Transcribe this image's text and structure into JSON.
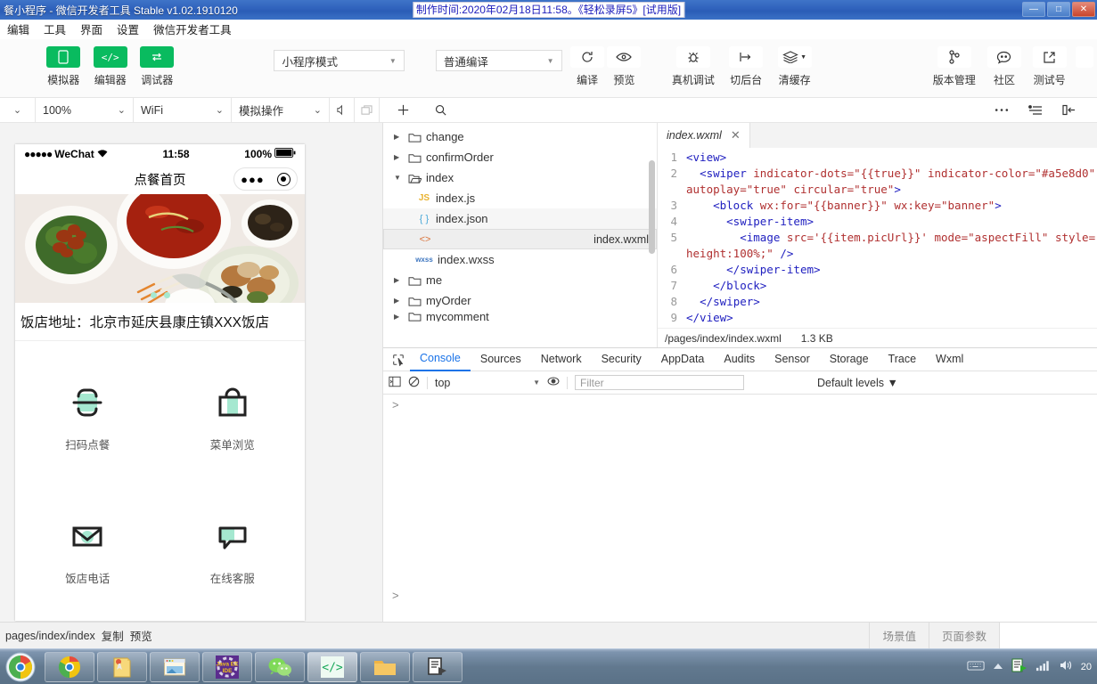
{
  "window": {
    "title": "餐小程序 - 微信开发者工具 Stable v1.02.1910120",
    "recording_overlay": "制作时间:2020年02月18日11:58。《轻松录屏5》[试用版]",
    "minimize": "—",
    "maximize": "□",
    "close": "✕"
  },
  "menubar": [
    "编辑",
    "工具",
    "界面",
    "设置",
    "微信开发者工具"
  ],
  "toolbar": {
    "left_items": [
      {
        "label": "模拟器",
        "icon": "simulator-icon",
        "glyph": "▯"
      },
      {
        "label": "编辑器",
        "icon": "editor-icon",
        "glyph": "‹/›"
      },
      {
        "label": "调试器",
        "icon": "debugger-icon",
        "glyph": "⇄"
      }
    ],
    "mode_select": "小程序模式",
    "compile_select": "普通编译",
    "actions": [
      {
        "label": "编译",
        "icon": "refresh-icon",
        "glyph": "↻"
      },
      {
        "label": "预览",
        "icon": "eye-icon",
        "glyph": "◉"
      },
      {
        "label": "真机调试",
        "icon": "bug-icon",
        "glyph": "※"
      },
      {
        "label": "切后台",
        "icon": "background-icon",
        "glyph": "↦"
      },
      {
        "label": "清缓存",
        "icon": "layers-icon",
        "glyph": "≋"
      }
    ],
    "right_actions": [
      {
        "label": "版本管理",
        "icon": "branch-icon",
        "glyph": "⑂"
      },
      {
        "label": "社区",
        "icon": "chat-icon",
        "glyph": "☺"
      },
      {
        "label": "测试号",
        "icon": "external-link-icon",
        "glyph": "↗"
      }
    ]
  },
  "toolbar2": {
    "device_caret": "⌄",
    "zoom": "100%",
    "network": "WiFi",
    "simulate": "模拟操作",
    "mute_icon": "speaker-icon",
    "window_icon": "window-icon",
    "add_icon": "plus-icon",
    "search_icon": "search-icon",
    "more_icon": "more-icon",
    "outline_icon": "outline-icon",
    "collapse_icon": "collapse-panel-icon"
  },
  "filetree": {
    "items": [
      {
        "label": "change",
        "type": "folder",
        "depth": 0,
        "arrow": "▶",
        "state": "normal"
      },
      {
        "label": "confirmOrder",
        "type": "folder",
        "depth": 0,
        "arrow": "▶",
        "state": "normal"
      },
      {
        "label": "index",
        "type": "folder-open",
        "depth": 0,
        "arrow": "▼",
        "state": "normal"
      },
      {
        "label": "index.js",
        "type": "js",
        "depth": 1,
        "arrow": "",
        "state": "normal"
      },
      {
        "label": "index.json",
        "type": "json",
        "depth": 1,
        "arrow": "",
        "state": "hover"
      },
      {
        "label": "index.wxml",
        "type": "wxml",
        "depth": 1,
        "arrow": "",
        "state": "selected"
      },
      {
        "label": "index.wxss",
        "type": "wxss",
        "depth": 1,
        "arrow": "",
        "state": "normal"
      },
      {
        "label": "me",
        "type": "folder",
        "depth": 0,
        "arrow": "▶",
        "state": "normal"
      },
      {
        "label": "myOrder",
        "type": "folder",
        "depth": 0,
        "arrow": "▶",
        "state": "normal"
      },
      {
        "label": "mycomment",
        "type": "folder",
        "depth": 0,
        "arrow": "▶",
        "state": "normal"
      }
    ],
    "icon_labels": {
      "js": "JS",
      "json": "{ }",
      "wxml": "<>",
      "wxss": "wxss",
      "folder": "🗀",
      "folder-open": "🗁"
    }
  },
  "editor": {
    "tab_name": "index.wxml",
    "tab_close": "✕",
    "file_path": "/pages/index/index.wxml",
    "file_size": "1.3 KB",
    "lines": [
      {
        "no": "1",
        "segments": [
          {
            "t": "<view>",
            "c": "tg"
          }
        ],
        "indent": 0
      },
      {
        "no": "2",
        "segments": [
          {
            "t": "<swiper ",
            "c": "tg"
          },
          {
            "t": "indicator-dots",
            "c": "at"
          },
          {
            "t": "=\"{{true}}\" ",
            "c": "vl"
          },
          {
            "t": "indicator-color",
            "c": "at"
          },
          {
            "t": "=\"#a5e8d0\"",
            "c": "vl"
          }
        ],
        "indent": 1
      },
      {
        "no": "",
        "segments": [
          {
            "t": "autoplay",
            "c": "at"
          },
          {
            "t": "=\"true\" ",
            "c": "vl"
          },
          {
            "t": "circular",
            "c": "at"
          },
          {
            "t": "=\"true\"",
            "c": "vl"
          },
          {
            "t": ">",
            "c": "tg"
          }
        ],
        "indent": 0
      },
      {
        "no": "3",
        "segments": [
          {
            "t": "<block ",
            "c": "tg"
          },
          {
            "t": "wx:for",
            "c": "at"
          },
          {
            "t": "=\"{{banner}}\" ",
            "c": "vl"
          },
          {
            "t": "wx:key",
            "c": "at"
          },
          {
            "t": "=\"banner\"",
            "c": "vl"
          },
          {
            "t": ">",
            "c": "tg"
          }
        ],
        "indent": 2
      },
      {
        "no": "4",
        "segments": [
          {
            "t": "<swiper-item>",
            "c": "tg"
          }
        ],
        "indent": 3
      },
      {
        "no": "5",
        "segments": [
          {
            "t": "<image ",
            "c": "tg"
          },
          {
            "t": "src",
            "c": "at"
          },
          {
            "t": "='{{item.picUrl}}' ",
            "c": "vl"
          },
          {
            "t": "mode",
            "c": "at"
          },
          {
            "t": "=\"aspectFill\" ",
            "c": "vl"
          },
          {
            "t": "style",
            "c": "at"
          },
          {
            "t": "=\"widtl",
            "c": "vl"
          }
        ],
        "indent": 4
      },
      {
        "no": "",
        "segments": [
          {
            "t": "height:100%;\" ",
            "c": "vl"
          },
          {
            "t": "/>",
            "c": "tg"
          }
        ],
        "indent": 0
      },
      {
        "no": "6",
        "segments": [
          {
            "t": "</swiper-item>",
            "c": "tg"
          }
        ],
        "indent": 3
      },
      {
        "no": "7",
        "segments": [
          {
            "t": "</block>",
            "c": "tg"
          }
        ],
        "indent": 2
      },
      {
        "no": "8",
        "segments": [
          {
            "t": "</swiper>",
            "c": "tg"
          }
        ],
        "indent": 1
      },
      {
        "no": "9",
        "segments": [
          {
            "t": "</view>",
            "c": "tg"
          }
        ],
        "indent": 0
      }
    ]
  },
  "devtools": {
    "inspect_icon": "inspect-element-icon",
    "tabs": [
      "Console",
      "Sources",
      "Network",
      "Security",
      "AppData",
      "Audits",
      "Sensor",
      "Storage",
      "Trace",
      "Wxml"
    ],
    "active_tab": "Console",
    "bar": {
      "sidebar_icon": "console-sidebar-icon",
      "clear_icon": "clear-console-icon",
      "context": "top",
      "context_caret": "▼",
      "eye_icon": "live-expression-icon",
      "filter_placeholder": "Filter",
      "levels": "Default levels ▼"
    },
    "prompt": ">"
  },
  "simulator": {
    "status": {
      "carrier": "WeChat",
      "signal_dots": "●●●●●",
      "wifi_icon": "wifi-icon",
      "time": "11:58",
      "battery_pct": "100%",
      "battery_icon": "battery-icon"
    },
    "nav_title": "点餐首页",
    "capsule": {
      "more": "●●●",
      "target_icon": "target-icon"
    },
    "banner": {
      "alt": "food-banner-image",
      "dots": 2,
      "active_dot": 1
    },
    "address": "饭店地址：北京市延庆县康庄镇XXX饭店",
    "menu_items": [
      {
        "label": "扫码点餐",
        "icon": "scan-code-icon"
      },
      {
        "label": "菜单浏览",
        "icon": "bag-menu-icon"
      },
      {
        "label": "饭店电话",
        "icon": "envelope-phone-icon"
      },
      {
        "label": "在线客服",
        "icon": "chat-support-icon"
      }
    ],
    "accent_color": "#a5e8d0"
  },
  "statusbar": {
    "path": "pages/index/index",
    "copy": "复制",
    "preview": "预览",
    "scene_value": "场景值",
    "page_params": "页面参数"
  },
  "taskbar": {
    "start_icon": "windows-start-icon",
    "apps": [
      {
        "name": "chrome-taskbar-icon",
        "active": false
      },
      {
        "name": "notepad-taskbar-icon",
        "active": false
      },
      {
        "name": "explorer-taskbar-icon",
        "active": false
      },
      {
        "name": "javaee-ide-taskbar-icon",
        "active": false
      },
      {
        "name": "wechat-taskbar-icon",
        "active": false
      },
      {
        "name": "wechat-devtools-taskbar-icon",
        "active": true
      },
      {
        "name": "folder-taskbar-icon",
        "active": false
      },
      {
        "name": "screen-recorder-taskbar-icon",
        "active": false
      }
    ],
    "tray": {
      "keyboard_icon": "keyboard-icon",
      "show_hidden_icon": "show-hidden-icons",
      "recorder_icon": "recorder-tray-icon",
      "network_icon": "network-signal-icon",
      "volume_icon": "volume-icon",
      "clock": "20"
    }
  }
}
